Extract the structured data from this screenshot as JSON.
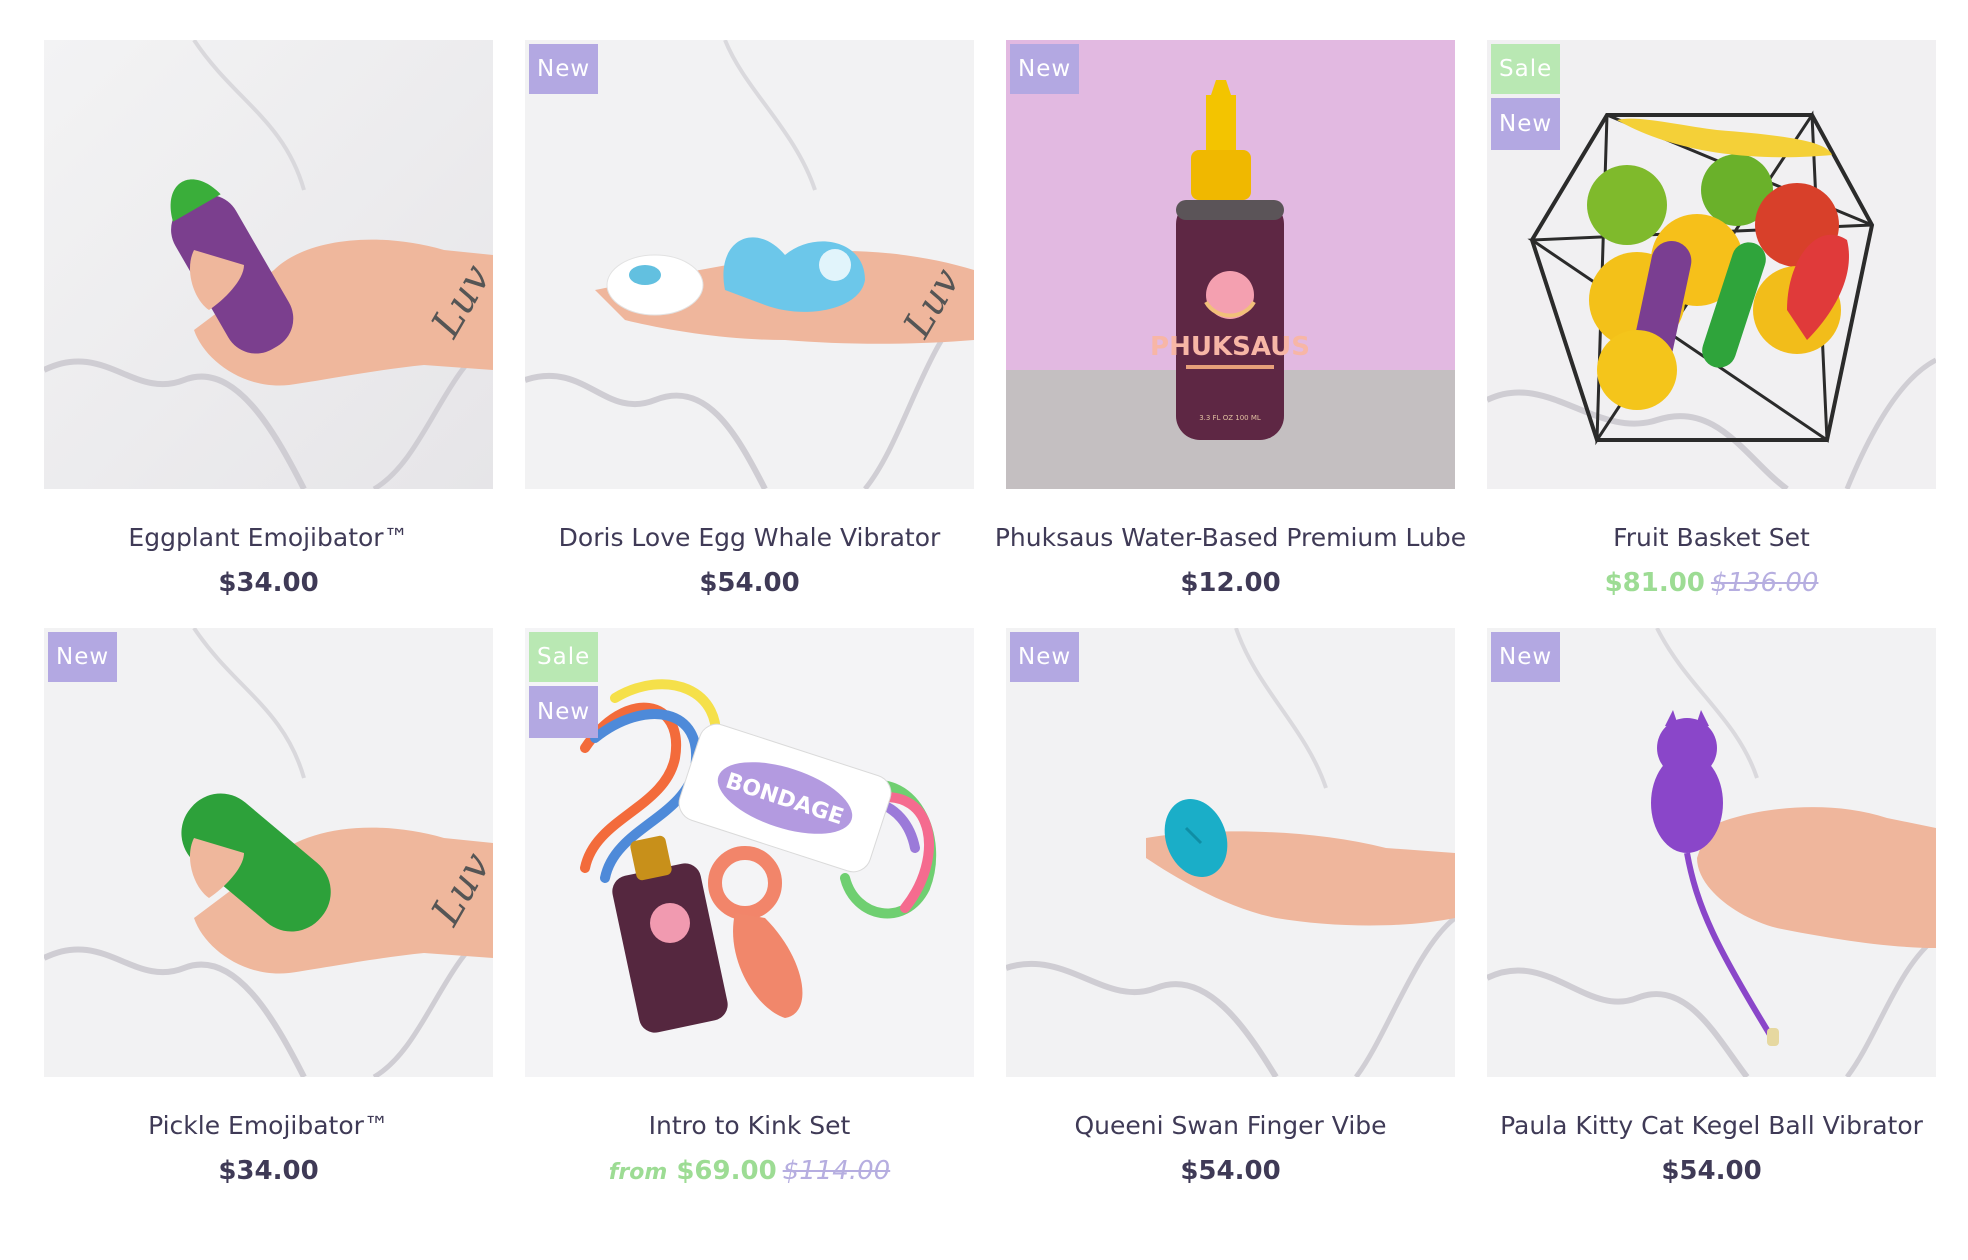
{
  "products": [
    {
      "title": "Eggplant Emojibator™",
      "price": "$34.00",
      "compare_price": "",
      "price_prefix": "",
      "on_sale": false,
      "badges": [],
      "image": "hand-holding-eggplant-vibrator"
    },
    {
      "title": "Doris Love Egg Whale Vibrator",
      "price": "$54.00",
      "compare_price": "",
      "price_prefix": "",
      "on_sale": false,
      "badges": [
        "New"
      ],
      "image": "hand-holding-whale-vibrator-and-remote"
    },
    {
      "title": "Phuksaus Water-Based Premium Lube",
      "price": "$12.00",
      "compare_price": "",
      "price_prefix": "",
      "on_sale": false,
      "badges": [
        "New"
      ],
      "image": "lube-bottle-on-pink-background"
    },
    {
      "title": "Fruit Basket Set",
      "price": "$81.00",
      "compare_price": "$136.00",
      "price_prefix": "",
      "on_sale": true,
      "badges": [
        "Sale",
        "New"
      ],
      "image": "fruit-basket-with-vibrators"
    },
    {
      "title": "Pickle Emojibator™",
      "price": "$34.00",
      "compare_price": "",
      "price_prefix": "",
      "on_sale": false,
      "badges": [
        "New"
      ],
      "image": "hand-holding-pickle-vibrator"
    },
    {
      "title": "Intro to Kink Set",
      "price": "$69.00",
      "compare_price": "$114.00",
      "price_prefix": "from",
      "on_sale": true,
      "badges": [
        "Sale",
        "New"
      ],
      "image": "rope-lube-and-plug-set"
    },
    {
      "title": "Queeni Swan Finger Vibe",
      "price": "$54.00",
      "compare_price": "",
      "price_prefix": "",
      "on_sale": false,
      "badges": [
        "New"
      ],
      "image": "hand-holding-swan-finger-vibe"
    },
    {
      "title": "Paula Kitty Cat Kegel Ball Vibrator",
      "price": "$54.00",
      "compare_price": "",
      "price_prefix": "",
      "on_sale": false,
      "badges": [
        "New"
      ],
      "image": "hand-holding-kitty-kegel-ball"
    }
  ],
  "colors": {
    "new_badge": "#b3a8e2",
    "sale_badge": "#b9e8b3",
    "sale_price": "#9ddc94",
    "compare_price": "#b6aee0",
    "text": "#3f3a56"
  }
}
